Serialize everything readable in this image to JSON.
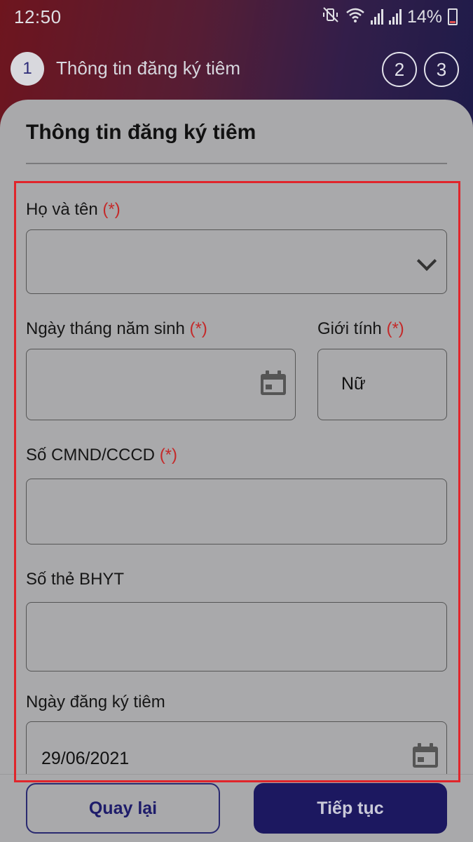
{
  "status_bar": {
    "time": "12:50",
    "battery": "14%",
    "icons": [
      "mute-vibrate-icon",
      "wifi-icon",
      "signal-icon",
      "signal-icon",
      "battery-icon"
    ]
  },
  "steps": {
    "active_number": "1",
    "active_title": "Thông tin đăng ký tiêm",
    "step2": "2",
    "step3": "3"
  },
  "form": {
    "title": "Thông tin đăng ký tiêm",
    "required_mark": "(*)",
    "full_name": {
      "label": "Họ và tên",
      "value": ""
    },
    "dob": {
      "label": "Ngày tháng năm sinh",
      "value": ""
    },
    "gender": {
      "label": "Giới tính",
      "value": "Nữ"
    },
    "id_number": {
      "label": "Số CMND/CCCD",
      "value": ""
    },
    "insurance": {
      "label": "Số thẻ BHYT",
      "value": ""
    },
    "register_date": {
      "label": "Ngày đăng ký tiêm",
      "value": "29/06/2021"
    }
  },
  "actions": {
    "back_label": "Quay lại",
    "next_label": "Tiếp tục"
  },
  "colors": {
    "highlight": "#e0252b",
    "primary": "#1c1860",
    "required": "#c42a2a"
  }
}
